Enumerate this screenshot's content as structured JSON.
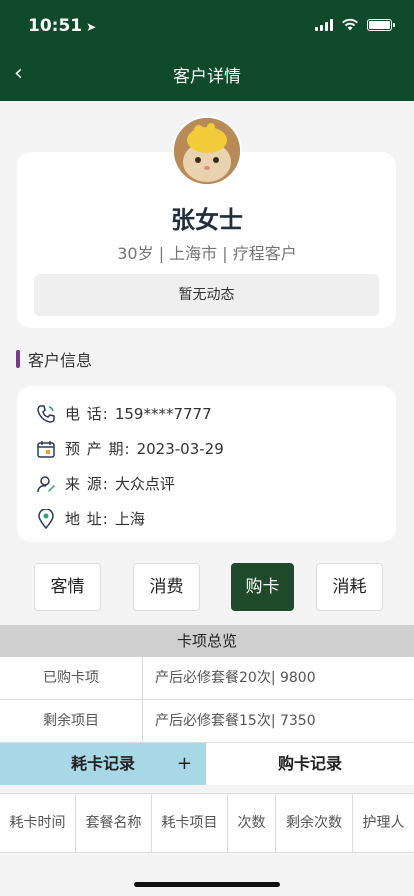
{
  "status": {
    "time": "10:51"
  },
  "nav": {
    "title": "客户详情"
  },
  "profile": {
    "name": "张女士",
    "meta": "30岁 | 上海市 | 疗程客户",
    "dynamic": "暂无动态"
  },
  "section": {
    "title": "客户信息"
  },
  "info": [
    {
      "icon": "phone-icon",
      "label": "电 话:",
      "value": "159****7777"
    },
    {
      "icon": "calendar-icon",
      "label": "预 产 期:",
      "value": "2023-03-29"
    },
    {
      "icon": "source-icon",
      "label": "来 源:",
      "value": "大众点评"
    },
    {
      "icon": "location-pin-icon",
      "label": "地 址:",
      "value": "上海"
    }
  ],
  "buttons": [
    {
      "label": "客情",
      "active": false
    },
    {
      "label": "消费",
      "active": false
    },
    {
      "label": "购卡",
      "active": true
    },
    {
      "label": "消耗",
      "active": false
    }
  ],
  "overview": {
    "title": "卡项总览",
    "rows": [
      {
        "label": "已购卡项",
        "value": "产后必修套餐20次| 9800"
      },
      {
        "label": "剩余项目",
        "value": "产后必修套餐15次| 7350"
      }
    ]
  },
  "tabs": {
    "left": "耗卡记录",
    "plus": "+",
    "right": "购卡记录"
  },
  "columns": [
    "耗卡时间",
    "套餐名称",
    "耗卡项目",
    "次数",
    "剩余次数",
    "护理人"
  ],
  "colors": {
    "header": "#0f4a2a",
    "active_button": "#1f4a2b",
    "tab_active": "#a8d8e6",
    "section_bar": "#7a3a8c"
  }
}
